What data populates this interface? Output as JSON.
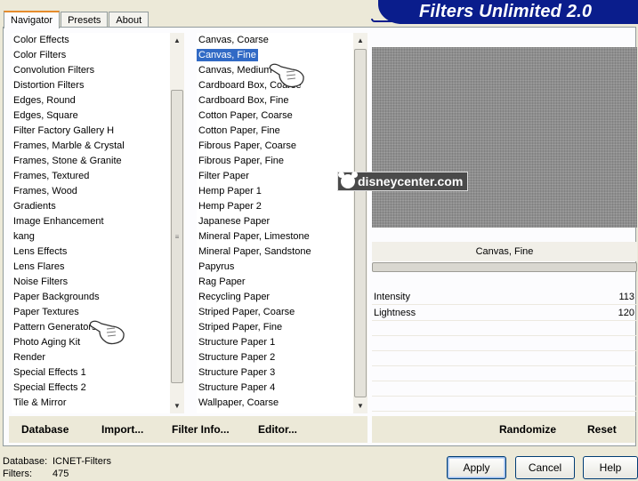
{
  "tabs": [
    "Navigator",
    "Presets",
    "About"
  ],
  "banner": "Filters Unlimited 2.0",
  "categories": [
    "Color Effects",
    "Color Filters",
    "Convolution Filters",
    "Distortion Filters",
    "Edges, Round",
    "Edges, Square",
    "Filter Factory Gallery H",
    "Frames, Marble & Crystal",
    "Frames, Stone & Granite",
    "Frames, Textured",
    "Frames, Wood",
    "Gradients",
    "Image Enhancement",
    "kang",
    "Lens Effects",
    "Lens Flares",
    "Noise Filters",
    "Paper Backgrounds",
    "Paper Textures",
    "Pattern Generators",
    "Photo Aging Kit",
    "Render",
    "Special Effects 1",
    "Special Effects 2",
    "Tile & Mirror"
  ],
  "filters": [
    "Canvas, Coarse",
    "Canvas, Fine",
    "Canvas, Medium",
    "Cardboard Box, Coarse",
    "Cardboard Box, Fine",
    "Cotton Paper, Coarse",
    "Cotton Paper, Fine",
    "Fibrous Paper, Coarse",
    "Fibrous Paper, Fine",
    "Filter Paper",
    "Hemp Paper 1",
    "Hemp Paper 2",
    "Japanese Paper",
    "Mineral Paper, Limestone",
    "Mineral Paper, Sandstone",
    "Papyrus",
    "Rag Paper",
    "Recycling Paper",
    "Striped Paper, Coarse",
    "Striped Paper, Fine",
    "Structure Paper 1",
    "Structure Paper 2",
    "Structure Paper 3",
    "Structure Paper 4",
    "Wallpaper, Coarse"
  ],
  "selected_filter_index": 1,
  "watermark": "disneycenter.com",
  "filter_name": "Canvas, Fine",
  "params": [
    {
      "label": "Intensity",
      "value": "113"
    },
    {
      "label": "Lightness",
      "value": "120"
    }
  ],
  "left_links": [
    "Database",
    "Import...",
    "Filter Info...",
    "Editor..."
  ],
  "right_links": [
    "Randomize",
    "Reset"
  ],
  "status": {
    "database_label": "Database:",
    "database_value": "ICNET-Filters",
    "filters_label": "Filters:",
    "filters_value": "475"
  },
  "buttons": {
    "apply": "Apply",
    "cancel": "Cancel",
    "help": "Help"
  },
  "colors": {
    "banner": "#0a1d8c",
    "selection": "#316ac5",
    "tab_highlight": "#e68b2c"
  }
}
